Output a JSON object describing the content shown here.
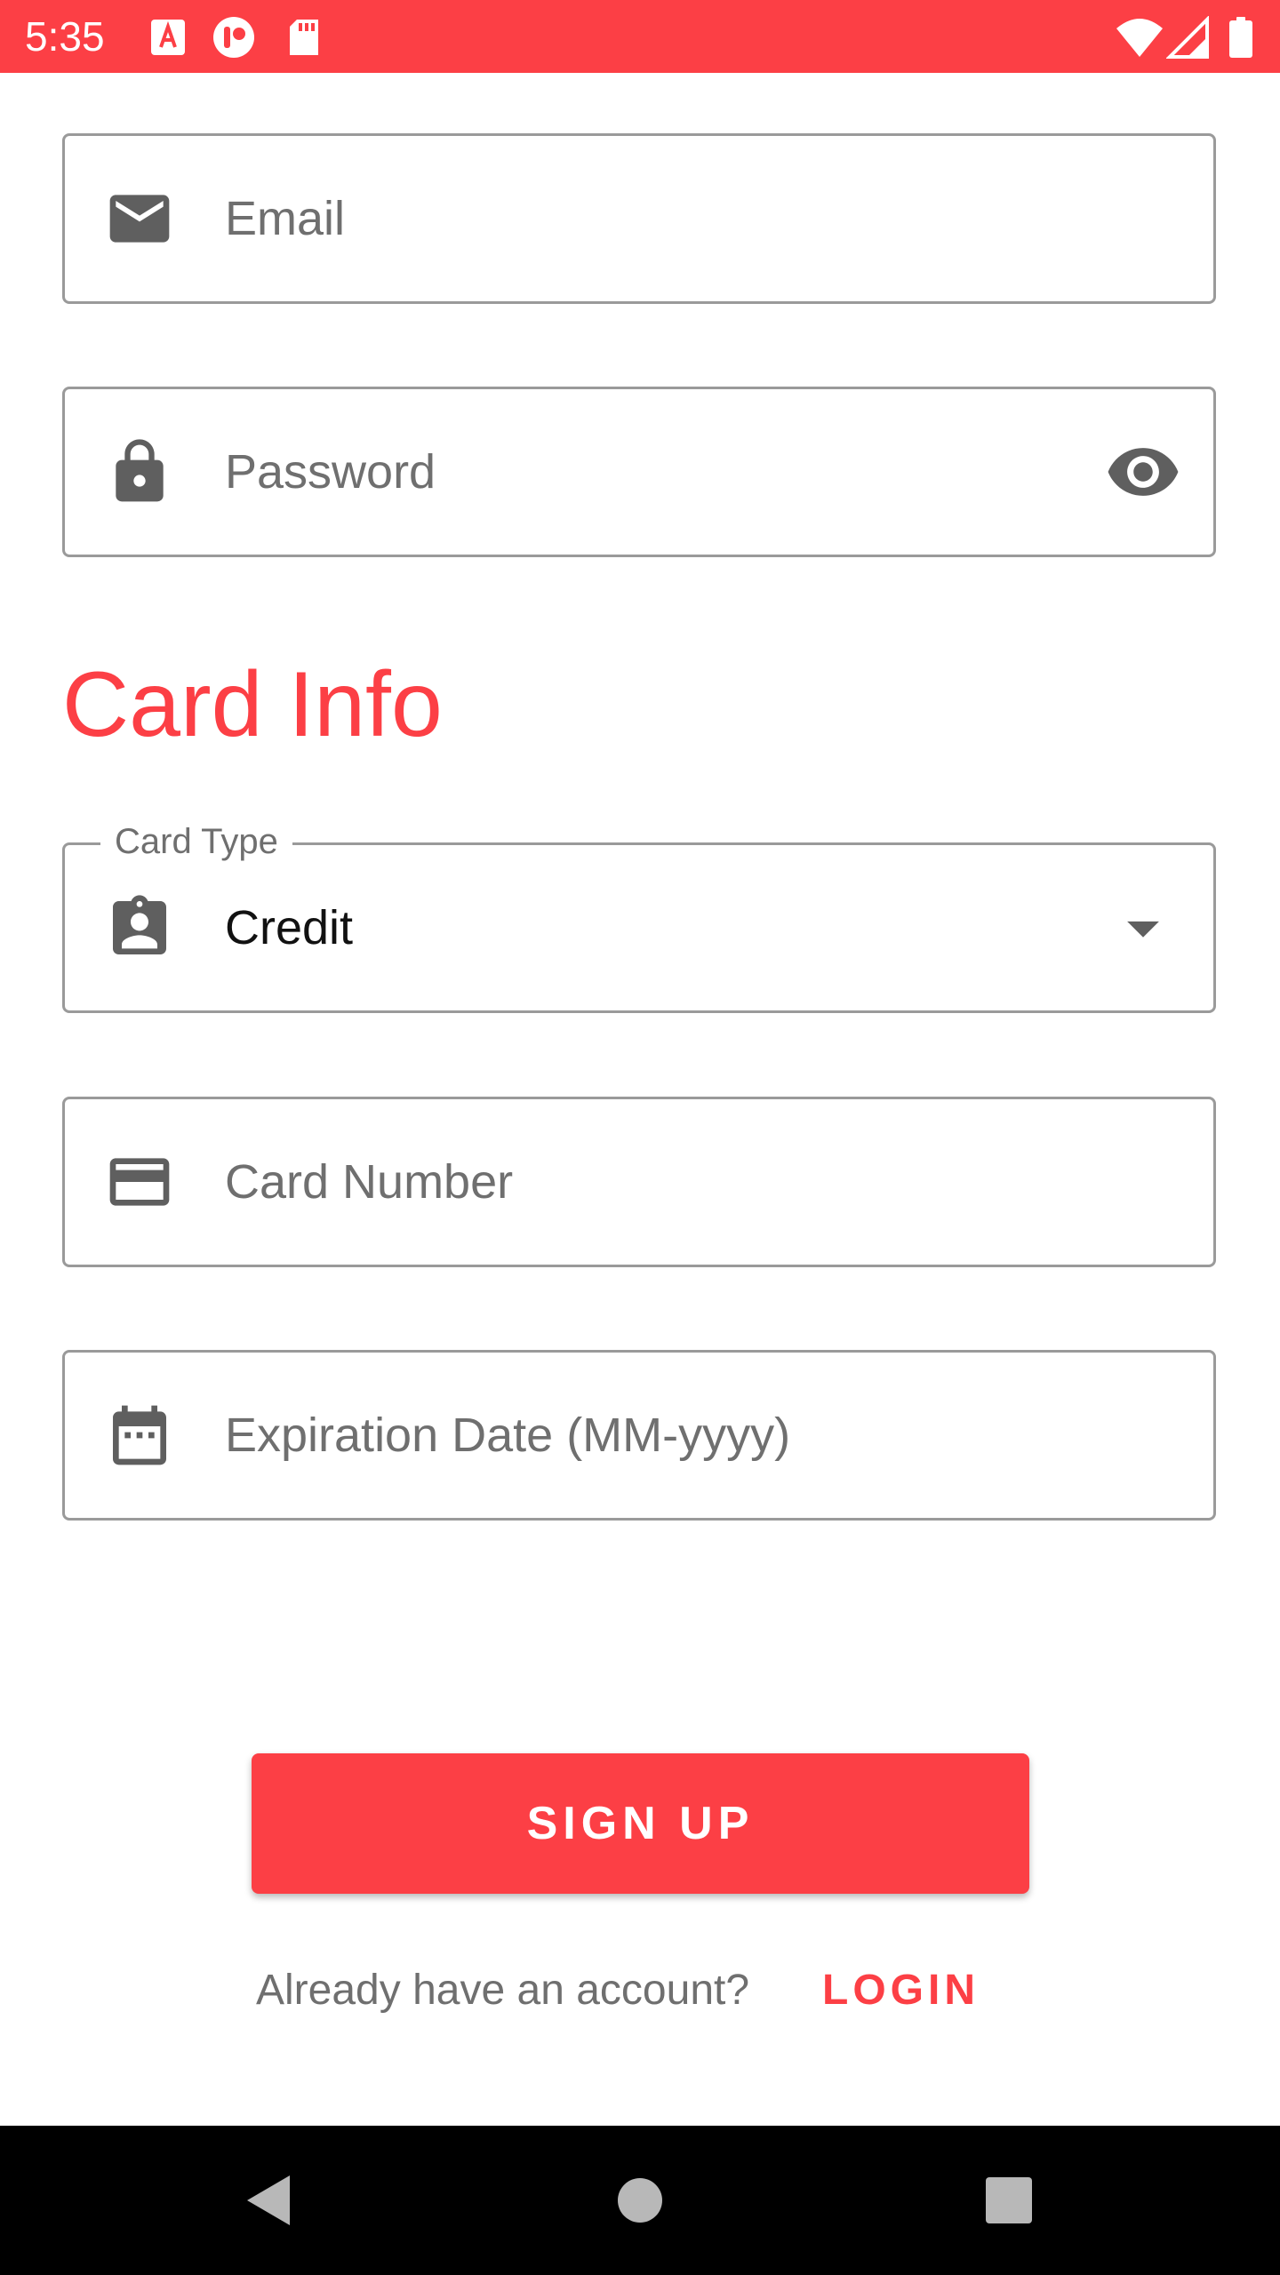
{
  "status_bar": {
    "time": "5:35",
    "color": "#fc3f45",
    "left_icons": [
      "font-a-icon",
      "record-app-icon",
      "sd-card-icon"
    ],
    "right_icons": [
      "wifi-icon",
      "cellular-signal-icon",
      "battery-icon"
    ]
  },
  "form": {
    "email": {
      "placeholder": "Email",
      "icon": "email-icon"
    },
    "password": {
      "placeholder": "Password",
      "icon": "lock-icon",
      "toggle_icon": "visibility-eye-icon"
    },
    "card_info_title": "Card Info",
    "card_type": {
      "label": "Card Type",
      "value": "Credit",
      "icon": "badge-icon",
      "dropdown_icon": "dropdown-arrow-icon"
    },
    "card_number": {
      "placeholder": "Card Number",
      "icon": "credit-card-icon"
    },
    "expiration_date": {
      "placeholder": "Expiration Date (MM-yyyy)",
      "icon": "calendar-icon"
    }
  },
  "actions": {
    "signup_label": "SIGN UP",
    "login_prompt": "Already have an account?",
    "login_label": "LOGIN"
  },
  "nav_bar": {
    "icons": [
      "back-icon",
      "home-icon",
      "recents-icon"
    ]
  },
  "colors": {
    "accent": "#fc3f45",
    "field_border": "#9a9a9a",
    "icon_gray": "#5f5f5f",
    "hint_text": "#6f6f6f",
    "nav_background": "#000000"
  }
}
